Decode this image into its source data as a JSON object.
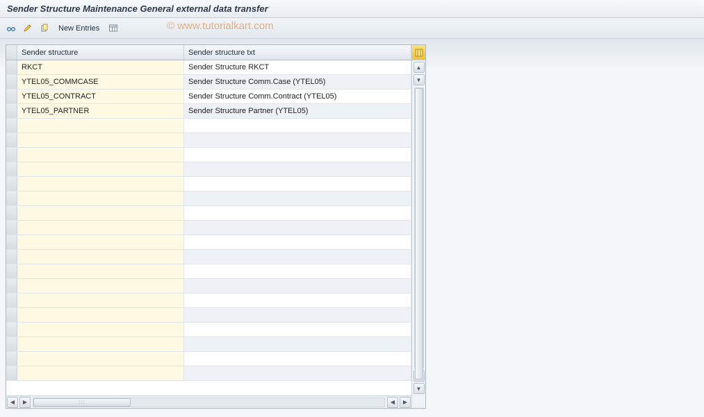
{
  "title": "Sender Structure Maintenance General external data transfer",
  "toolbar": {
    "new_entries_label": "New Entries"
  },
  "watermark": "© www.tutorialkart.com",
  "table": {
    "columns": {
      "sender_structure": "Sender structure",
      "sender_structure_txt": "Sender structure txt"
    },
    "rows": [
      {
        "structure": "RKCT",
        "txt": "Sender Structure RKCT"
      },
      {
        "structure": "YTEL05_COMMCASE",
        "txt": "Sender Structure Comm.Case (YTEL05)"
      },
      {
        "structure": "YTEL05_CONTRACT",
        "txt": "Sender Structure Comm.Contract (YTEL05)"
      },
      {
        "structure": "YTEL05_PARTNER",
        "txt": "Sender Structure Partner (YTEL05)"
      }
    ],
    "total_visible_rows": 22
  }
}
